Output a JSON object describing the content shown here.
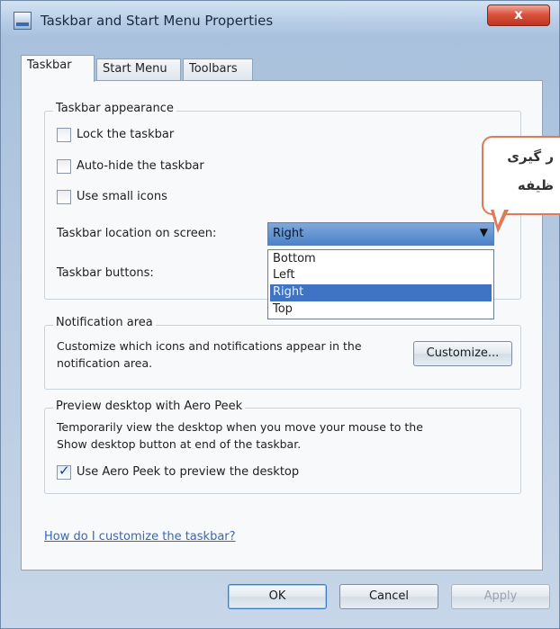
{
  "window": {
    "title": "Taskbar and Start Menu Properties",
    "close_glyph": "x"
  },
  "tabs": [
    {
      "label": "Taskbar",
      "active": true
    },
    {
      "label": "Start Menu",
      "active": false
    },
    {
      "label": "Toolbars",
      "active": false
    }
  ],
  "appearance": {
    "title": "Taskbar appearance",
    "lock": {
      "label": "Lock the taskbar",
      "checked": false
    },
    "autohide": {
      "label": "Auto-hide the taskbar",
      "checked": false
    },
    "small_icons": {
      "label": "Use small icons",
      "checked": false
    },
    "location_label": "Taskbar location on screen:",
    "location_value": "Right",
    "location_options": [
      "Bottom",
      "Left",
      "Right",
      "Top"
    ],
    "buttons_label": "Taskbar buttons:"
  },
  "notification": {
    "title": "Notification area",
    "text_line1": "Customize which icons and notifications appear in the",
    "text_line2": "notification area.",
    "customize_label": "Customize..."
  },
  "aero_peek": {
    "title": "Preview desktop with Aero Peek",
    "text_line1": "Temporarily view the desktop when you move your mouse to the",
    "text_line2": "Show desktop button at end of the taskbar.",
    "checkbox": {
      "label": "Use Aero Peek to preview the desktop",
      "checked": true
    }
  },
  "help_link": "How do I customize the taskbar?",
  "buttons": {
    "ok": "OK",
    "cancel": "Cancel",
    "apply": "Apply"
  },
  "callout": {
    "line1": "ر گیری",
    "line2": "ظیفه"
  },
  "colors": {
    "selection": "#3f74c4",
    "link": "#3a66b8",
    "callout_border": "#e07a56"
  }
}
